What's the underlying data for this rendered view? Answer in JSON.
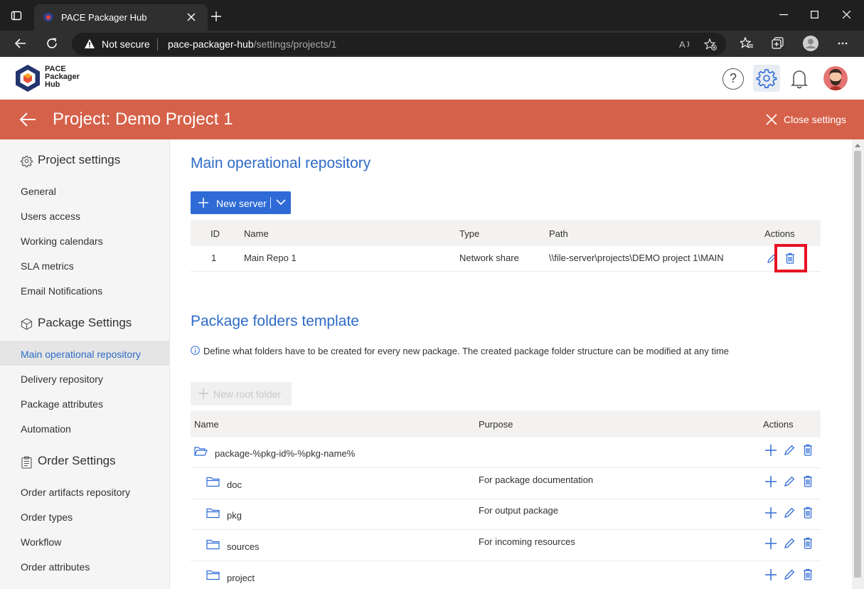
{
  "browser": {
    "tab_title": "PACE Packager Hub",
    "security_label": "Not secure",
    "url_host": "pace-packager-hub",
    "url_path": "/settings/projects/1"
  },
  "app": {
    "logo_lines": [
      "PACE",
      "Packager",
      "Hub"
    ],
    "help_label": "?"
  },
  "band": {
    "title": "Project: Demo Project 1",
    "close_label": "Close settings"
  },
  "sidebar": {
    "sections": [
      {
        "title": "Project settings",
        "icon": "gear-icon",
        "items": [
          "General",
          "Users access",
          "Working calendars",
          "SLA metrics",
          "Email Notifications"
        ]
      },
      {
        "title": "Package Settings",
        "icon": "cube-icon",
        "items": [
          "Main operational repository",
          "Delivery repository",
          "Package attributes",
          "Automation"
        ]
      },
      {
        "title": "Order Settings",
        "icon": "clipboard-icon",
        "items": [
          "Order artifacts repository",
          "Order types",
          "Workflow",
          "Order attributes"
        ]
      }
    ],
    "active_item": "Main operational repository"
  },
  "repo": {
    "heading": "Main operational repository",
    "new_server_label": "New server",
    "columns": [
      "ID",
      "Name",
      "Type",
      "Path",
      "Actions"
    ],
    "rows": [
      {
        "id": "1",
        "name": "Main Repo 1",
        "type": "Network share",
        "path": "\\\\file-server\\projects\\DEMO project 1\\MAIN"
      }
    ]
  },
  "folders": {
    "heading": "Package folders template",
    "info": "Define what folders have to be created for every new package. The created package folder structure can be modified at any time",
    "new_root_label": "New root folder",
    "columns": [
      "Name",
      "Purpose",
      "Actions"
    ],
    "rows": [
      {
        "name": "package-%pkg-id%-%pkg-name%",
        "purpose": "",
        "root": true
      },
      {
        "name": "doc",
        "purpose": "For package documentation",
        "root": false
      },
      {
        "name": "pkg",
        "purpose": "For output package",
        "root": false
      },
      {
        "name": "sources",
        "purpose": "For incoming resources",
        "root": false
      },
      {
        "name": "project",
        "purpose": "",
        "root": false
      }
    ]
  },
  "colors": {
    "accent": "#2e6bd6",
    "band": "#d6614a",
    "highlight": "#e81123"
  }
}
